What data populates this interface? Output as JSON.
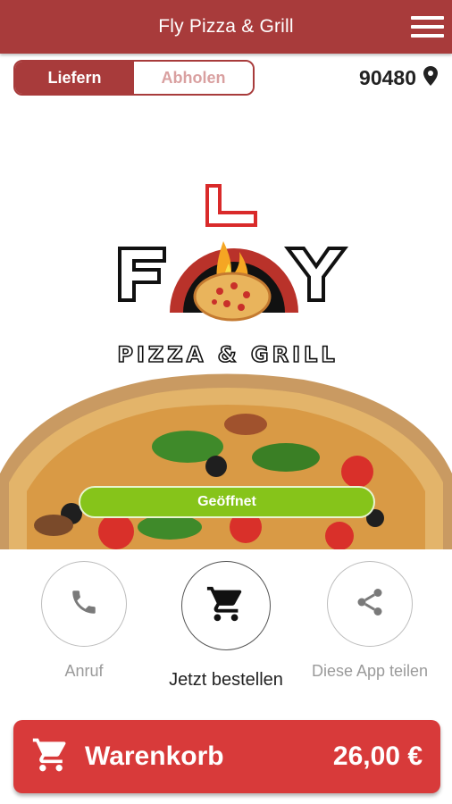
{
  "header": {
    "title": "Fly Pizza & Grill",
    "menu_icon": "hamburger-menu-icon"
  },
  "mode_toggle": {
    "options": [
      "Liefern",
      "Abholen"
    ],
    "selected": "Liefern"
  },
  "location": {
    "zip": "90480",
    "icon": "location-pin-icon"
  },
  "hero": {
    "logo_text": "FLY PIZZA & GRILL",
    "status": "Geöffnet",
    "status_color": "#86c41a"
  },
  "actions": [
    {
      "label": "Anruf",
      "icon": "phone-icon"
    },
    {
      "label": "Jetzt bestellen",
      "icon": "cart-icon"
    },
    {
      "label": "Diese App teilen",
      "icon": "share-icon"
    }
  ],
  "cart": {
    "label": "Warenkorb",
    "total": "26,00 €",
    "icon": "cart-icon"
  },
  "colors": {
    "brand": "#a83b3b",
    "cart_bar": "#d83a3a",
    "open": "#86c41a"
  }
}
